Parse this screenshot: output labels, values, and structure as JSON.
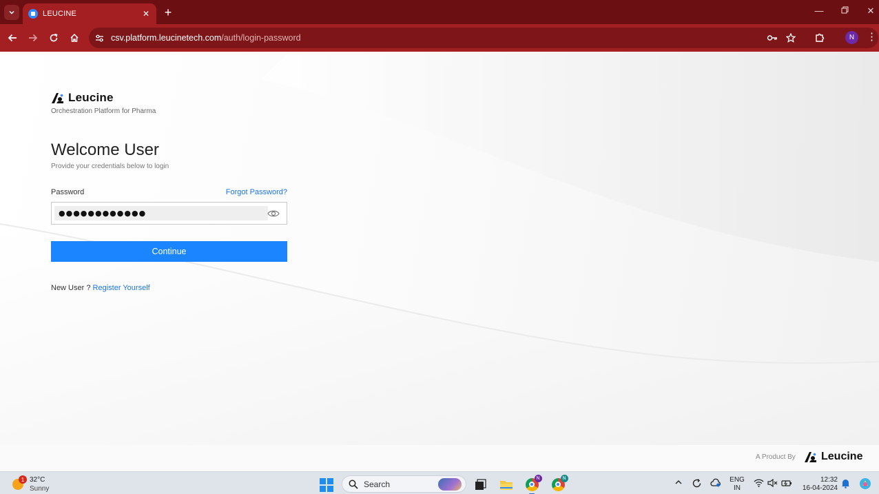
{
  "browser": {
    "tab_title": "LEUCINE",
    "url_host": "csv.platform.leucinetech.com",
    "url_path": "/auth/login-password",
    "profile_initial": "N",
    "accent_color": "#a31f22"
  },
  "page": {
    "brand_name": "Leucine",
    "brand_tagline": "Orchestration Platform for Pharma",
    "welcome_title": "Welcome User",
    "welcome_subtitle": "Provide your credentials below to login",
    "password_label": "Password",
    "forgot_password": "Forgot Password?",
    "password_value": "●●●●●●●●●●●●",
    "continue_label": "Continue",
    "new_user_text": "New User ?",
    "register_link": "Register Yourself",
    "primary_color": "#1a85ff",
    "link_color": "#1a73e8"
  },
  "footer": {
    "product_by": "A Product By",
    "brand_name": "Leucine"
  },
  "taskbar": {
    "weather_badge": "1",
    "temperature": "32°C",
    "condition": "Sunny",
    "search_label": "Search",
    "chrome_profile_1": "N",
    "chrome_profile_2": "N",
    "lang_line1": "ENG",
    "lang_line2": "IN",
    "time": "12:32",
    "date": "16-04-2024"
  }
}
